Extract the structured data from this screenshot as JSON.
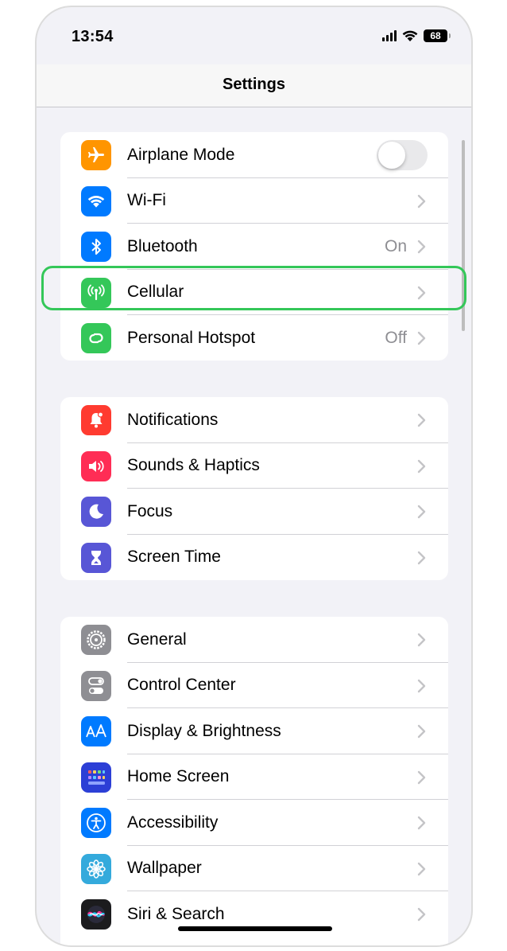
{
  "status_bar": {
    "time": "13:54",
    "battery": "68"
  },
  "nav": {
    "title": "Settings"
  },
  "groups": [
    {
      "items": [
        {
          "label": "Airplane Mode",
          "icon": "airplane-icon",
          "color": "#ff9500",
          "toggle": false
        },
        {
          "label": "Wi-Fi",
          "icon": "wifi-icon",
          "color": "#007aff"
        },
        {
          "label": "Bluetooth",
          "icon": "bluetooth-icon",
          "color": "#007aff",
          "value": "On"
        },
        {
          "label": "Cellular",
          "icon": "antenna-icon",
          "color": "#34c759",
          "highlighted": true
        },
        {
          "label": "Personal Hotspot",
          "icon": "hotspot-icon",
          "color": "#34c759",
          "value": "Off"
        }
      ]
    },
    {
      "items": [
        {
          "label": "Notifications",
          "icon": "bell-icon",
          "color": "#ff3b30"
        },
        {
          "label": "Sounds & Haptics",
          "icon": "speaker-icon",
          "color": "#ff2d55"
        },
        {
          "label": "Focus",
          "icon": "moon-icon",
          "color": "#5856d6"
        },
        {
          "label": "Screen Time",
          "icon": "hourglass-icon",
          "color": "#5856d6"
        }
      ]
    },
    {
      "items": [
        {
          "label": "General",
          "icon": "gear-icon",
          "color": "#8e8e93"
        },
        {
          "label": "Control Center",
          "icon": "switches-icon",
          "color": "#8e8e93"
        },
        {
          "label": "Display & Brightness",
          "icon": "text-size-icon",
          "color": "#007aff"
        },
        {
          "label": "Home Screen",
          "icon": "app-grid-icon",
          "color": "#2c3fd6"
        },
        {
          "label": "Accessibility",
          "icon": "accessibility-icon",
          "color": "#007aff"
        },
        {
          "label": "Wallpaper",
          "icon": "flower-icon",
          "color": "#34aadc"
        },
        {
          "label": "Siri & Search",
          "icon": "siri-icon",
          "color": "#1c1c1e"
        }
      ]
    }
  ]
}
